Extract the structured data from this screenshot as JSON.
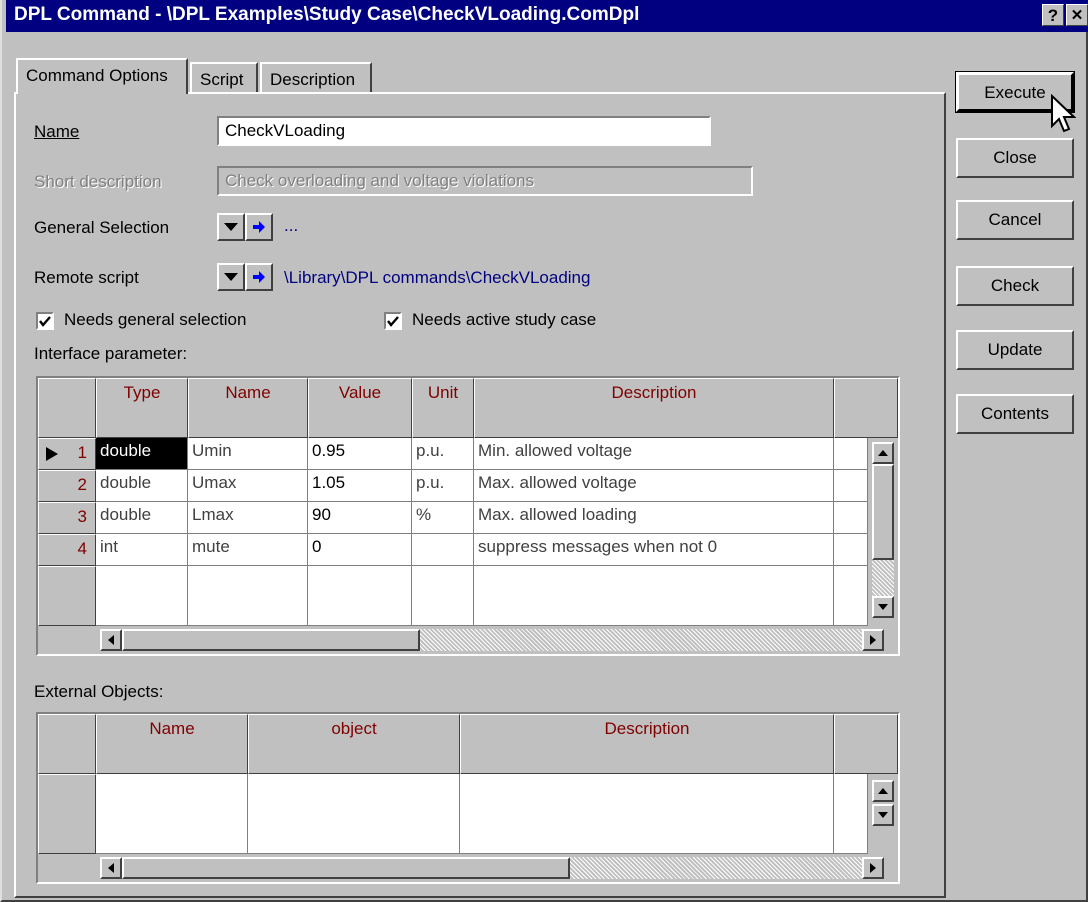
{
  "window": {
    "title": "DPL Command - \\DPL Examples\\Study Case\\CheckVLoading.ComDpl",
    "help_glyph": "?",
    "close_glyph": "✕"
  },
  "tabs": [
    {
      "label": "Command Options"
    },
    {
      "label": "Script"
    },
    {
      "label": "Description"
    }
  ],
  "form": {
    "name_label": "Name",
    "name_value": "CheckVLoading",
    "short_desc_label": "Short description",
    "short_desc_value": "Check overloading and voltage violations",
    "general_selection_label": "General Selection",
    "general_selection_value": "...",
    "remote_script_label": "Remote script",
    "remote_script_value": "\\Library\\DPL commands\\CheckVLoading",
    "needs_general_selection": "Needs general selection",
    "needs_active_study_case": "Needs active study case",
    "interface_param_label": "Interface parameter:",
    "external_objects_label": "External Objects:"
  },
  "params_table": {
    "headers": [
      "Type",
      "Name",
      "Value",
      "Unit",
      "Description"
    ],
    "rows": [
      {
        "num": "1",
        "type": "double",
        "name": "Umin",
        "value": "0.95",
        "unit": "p.u.",
        "desc": "Min. allowed voltage"
      },
      {
        "num": "2",
        "type": "double",
        "name": "Umax",
        "value": "1.05",
        "unit": "p.u.",
        "desc": "Max. allowed voltage"
      },
      {
        "num": "3",
        "type": "double",
        "name": "Lmax",
        "value": "90",
        "unit": "%",
        "desc": "Max. allowed loading"
      },
      {
        "num": "4",
        "type": "int",
        "name": "mute",
        "value": "0",
        "unit": "",
        "desc": "suppress messages when not 0"
      }
    ]
  },
  "ext_table": {
    "headers": [
      "Name",
      "object",
      "Description"
    ]
  },
  "buttons": {
    "execute": "Execute",
    "close": "Close",
    "cancel": "Cancel",
    "check": "Check",
    "update": "Update",
    "contents": "Contents"
  },
  "colors": {
    "title_bg": "#000080",
    "header_text": "#800000",
    "link_text": "#000080",
    "arrow_blue": "#0000ff"
  },
  "icons": {
    "dropdown": "triangle-down-icon",
    "jump": "arrow-right-icon",
    "row_pointer": "triangle-right-icon",
    "cursor": "mouse-pointer-icon"
  }
}
